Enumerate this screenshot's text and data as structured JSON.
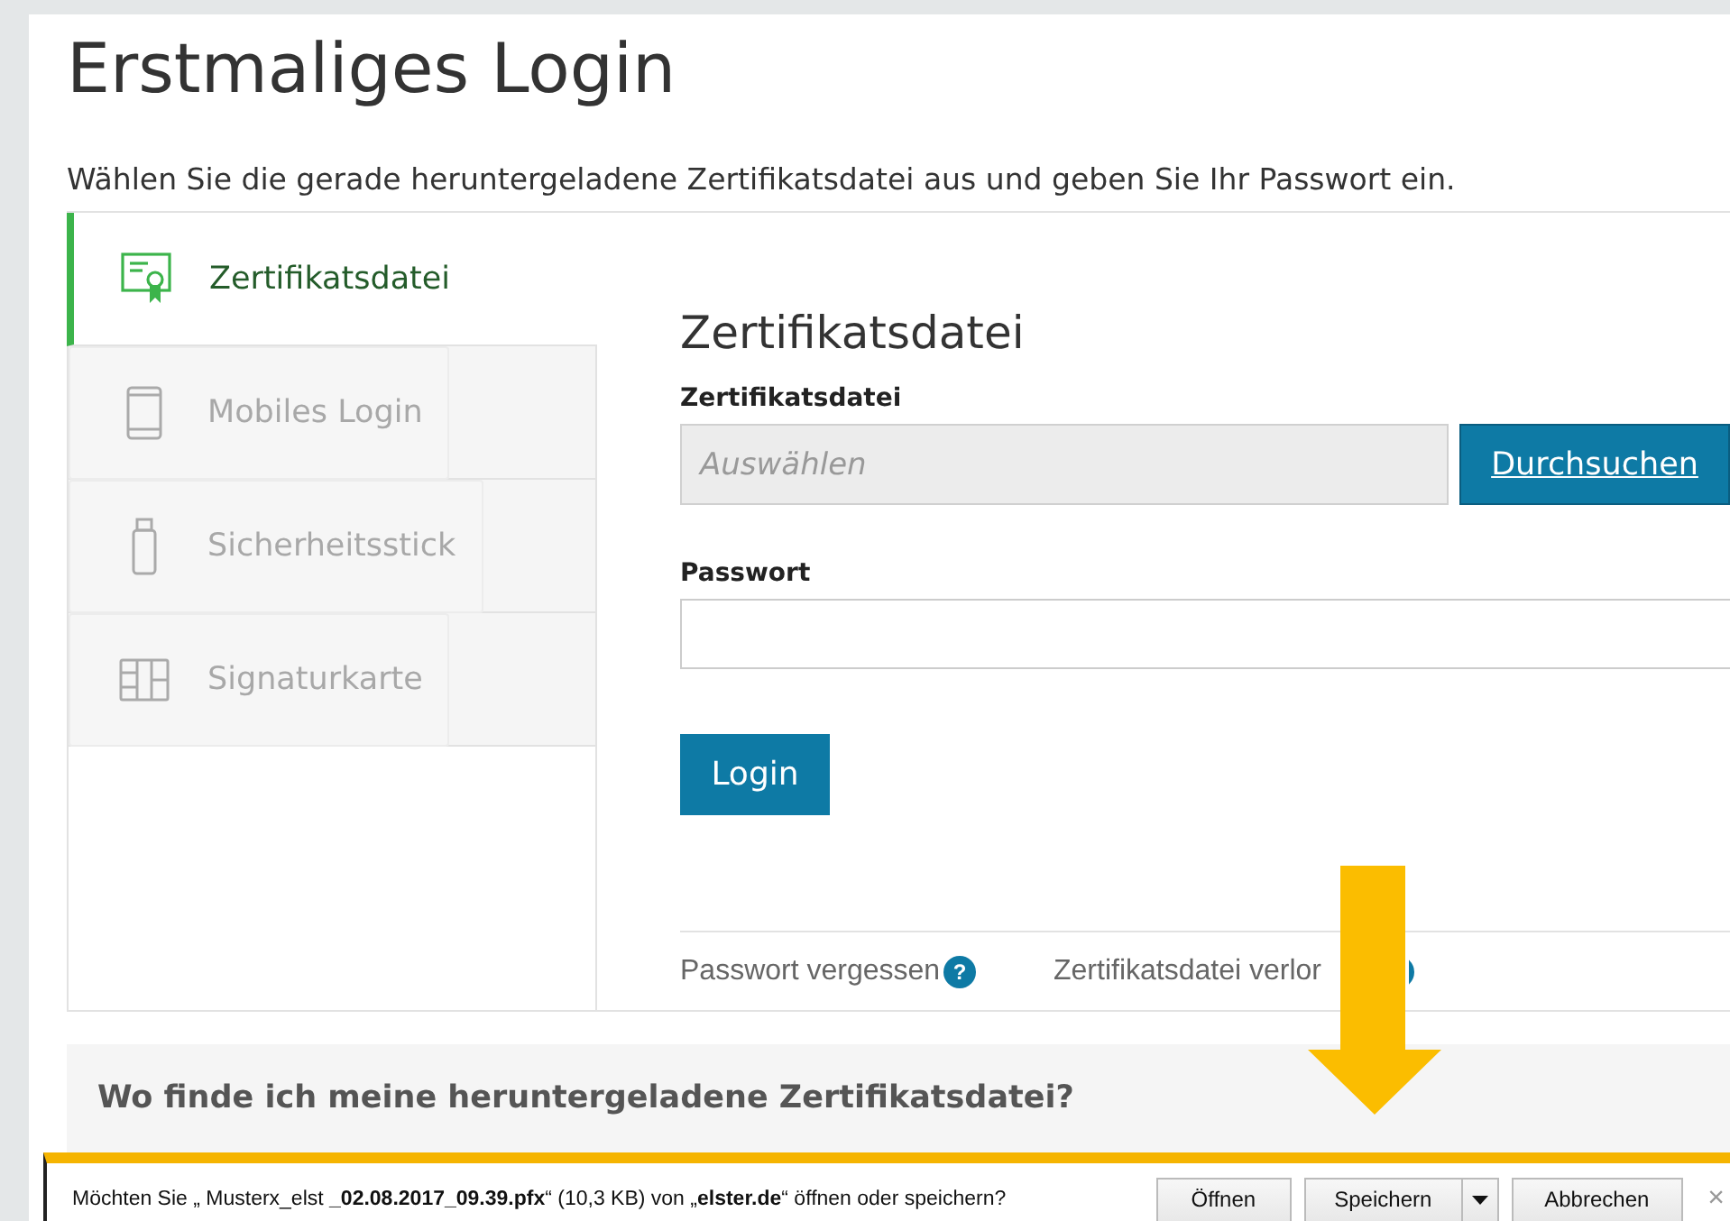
{
  "page": {
    "title": "Erstmaliges Login",
    "subtitle": "Wählen Sie die gerade heruntergeladene Zertifikatsdatei aus und geben Sie Ihr Passwort ein."
  },
  "tabs": [
    {
      "label": "Zertifikatsdatei",
      "selected": true
    },
    {
      "label": "Mobiles Login",
      "selected": false
    },
    {
      "label": "Sicherheitsstick",
      "selected": false
    },
    {
      "label": "Signaturkarte",
      "selected": false
    }
  ],
  "form": {
    "heading": "Zertifikatsdatei",
    "file_label": "Zertifikatsdatei",
    "file_placeholder": "Auswählen",
    "browse_button": "Durchsuchen",
    "password_label": "Passwort",
    "login_button": "Login",
    "links": [
      {
        "label": "Passwort vergessen",
        "help": "?"
      },
      {
        "label": "Zertifikatsdatei verlor"
      }
    ]
  },
  "help_section": {
    "heading": "Wo finde ich meine heruntergeladene Zertifikatsdatei?"
  },
  "download_bar": {
    "message": "Möchten Sie „ Musterx_elst **_02.08.2017_09.39.pfx**“ (10,3 KB) von „**elster.de**“ öffnen oder speichern?",
    "buttons": [
      "Öffnen",
      "Speichern",
      "Abbrechen"
    ],
    "close": "×"
  }
}
